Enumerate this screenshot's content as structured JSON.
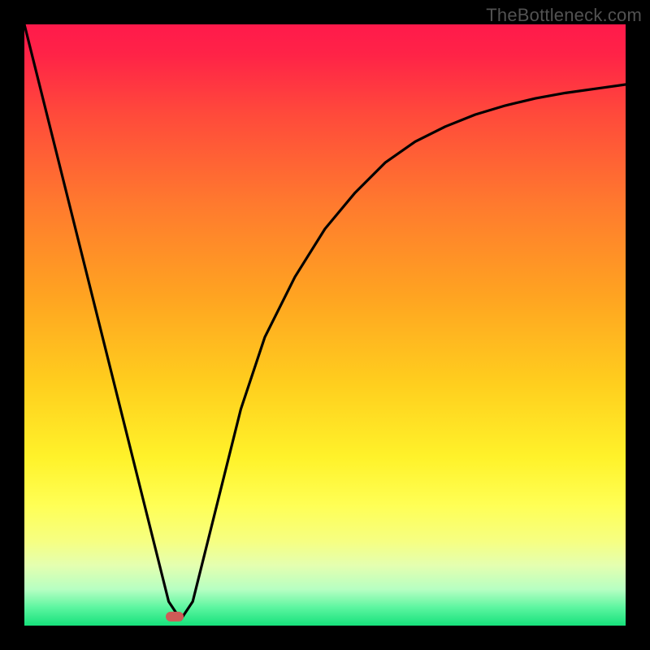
{
  "watermark": "TheBottleneck.com",
  "chart_data": {
    "type": "line",
    "title": "",
    "xlabel": "",
    "ylabel": "",
    "xlim": [
      0,
      100
    ],
    "ylim": [
      0,
      100
    ],
    "x": [
      0,
      5,
      10,
      15,
      20,
      24,
      26,
      28,
      30,
      33,
      36,
      40,
      45,
      50,
      55,
      60,
      65,
      70,
      75,
      80,
      85,
      90,
      95,
      100
    ],
    "values": [
      100,
      80,
      60,
      40,
      20,
      4,
      1,
      4,
      12,
      24,
      36,
      48,
      58,
      66,
      72,
      77,
      80.5,
      83,
      85,
      86.5,
      87.7,
      88.6,
      89.3,
      90
    ],
    "marker": {
      "x": 25,
      "y": 1.5
    },
    "gradient_stops": [
      {
        "offset": 0.0,
        "color": "#ff1a4b"
      },
      {
        "offset": 0.05,
        "color": "#ff2347"
      },
      {
        "offset": 0.15,
        "color": "#ff4a3b"
      },
      {
        "offset": 0.3,
        "color": "#ff7a2e"
      },
      {
        "offset": 0.45,
        "color": "#ffa321"
      },
      {
        "offset": 0.6,
        "color": "#ffcf1e"
      },
      {
        "offset": 0.72,
        "color": "#fff22a"
      },
      {
        "offset": 0.8,
        "color": "#ffff55"
      },
      {
        "offset": 0.86,
        "color": "#f6ff82"
      },
      {
        "offset": 0.9,
        "color": "#e4ffb0"
      },
      {
        "offset": 0.94,
        "color": "#b6ffc2"
      },
      {
        "offset": 0.97,
        "color": "#5cf5a0"
      },
      {
        "offset": 1.0,
        "color": "#16e17b"
      }
    ]
  }
}
